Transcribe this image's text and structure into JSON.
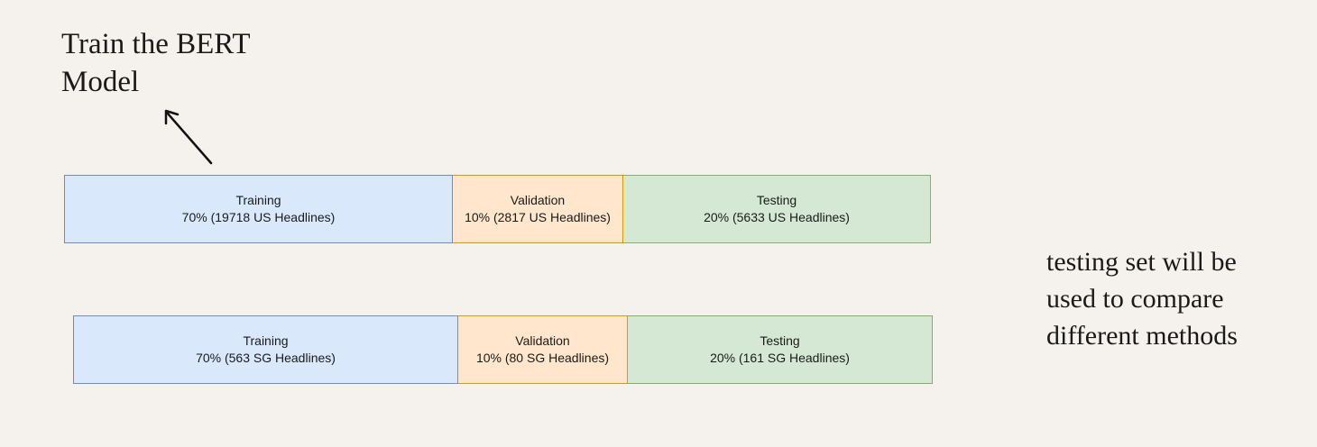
{
  "annotations": {
    "train_bert": "Train the BERT\nModel",
    "testing_note": "testing set will be\nused to compare\ndifferent methods"
  },
  "us_split": {
    "training": {
      "title": "Training",
      "detail": "70% (19718 US Headlines)"
    },
    "validation": {
      "title": "Validation",
      "detail": "10% (2817 US Headlines)"
    },
    "testing": {
      "title": "Testing",
      "detail": "20% (5633 US Headlines)"
    }
  },
  "sg_split": {
    "training": {
      "title": "Training",
      "detail": "70% (563 SG Headlines)"
    },
    "validation": {
      "title": "Validation",
      "detail": "10% (80 SG Headlines)"
    },
    "testing": {
      "title": "Testing",
      "detail": "20% (161 SG Headlines)"
    }
  },
  "colors": {
    "background": "#f5f2ee",
    "training_fill": "#dae8fc",
    "training_stroke": "#6c8ebf",
    "validation_fill": "#ffe6cc",
    "validation_stroke": "#d79b00",
    "testing_fill": "#d5e8d4",
    "testing_stroke": "#82b366"
  }
}
